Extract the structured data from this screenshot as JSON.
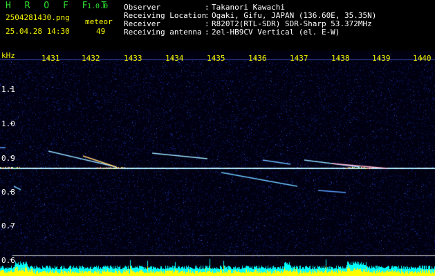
{
  "app": {
    "name": "H R O F F T",
    "version": "1.0.0"
  },
  "file": {
    "name": "2504281430.png",
    "datetime": "25.04.28 14:30"
  },
  "counter": {
    "label": "meteor",
    "value": "49"
  },
  "info": [
    {
      "key": "Observer",
      "sep": ":",
      "value": "Takanori Kawachi"
    },
    {
      "key": "Receiving Location",
      "sep": ":",
      "value": "Ogaki, Gifu, JAPAN (136.60E, 35.35N)"
    },
    {
      "key": "Receiver",
      "sep": ":",
      "value": "R820T2(RTL-SDR) SDR-Sharp 53.372MHz"
    },
    {
      "key": "Receiving antenna",
      "sep": ":",
      "value": "2el-HB9CV Vertical (el. E-W)"
    }
  ],
  "axis": {
    "y_unit": "kHz",
    "x_ticks": [
      "1431",
      "1432",
      "1433",
      "1434",
      "1435",
      "1436",
      "1437",
      "1438",
      "1439",
      "1440"
    ],
    "y_ticks": [
      "1.1",
      "1.0",
      "0.9",
      "0.8",
      "0.7",
      "0.6"
    ]
  },
  "colors": {
    "background": "#000000",
    "noise": "#1a2a8a",
    "carrier": "#b0f0ff",
    "meteor": "#70c8ff",
    "level_fill": "#00ffff",
    "level_peak": "#ffff00"
  }
}
